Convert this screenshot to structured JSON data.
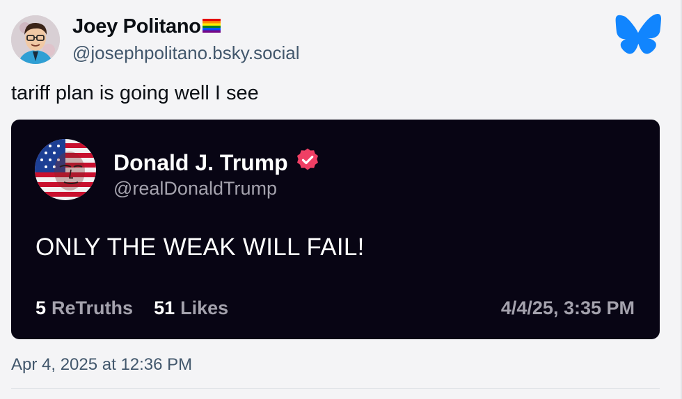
{
  "author": {
    "display_name": "Joey Politano",
    "handle": "@josephpolitano.bsky.social",
    "flag_icon": "rainbow-flag-icon"
  },
  "platform_logo": "bluesky-butterfly-icon",
  "post": {
    "text": "tariff plan is going well I see",
    "timestamp": "Apr 4, 2025 at 12:36 PM"
  },
  "embed": {
    "display_name": "Donald J. Trump",
    "handle": "@realDonaldTrump",
    "verified_icon": "verified-badge-icon",
    "text": "ONLY THE WEAK WILL FAIL!",
    "retruths_count": "5",
    "retruths_label": "ReTruths",
    "likes_count": "51",
    "likes_label": "Likes",
    "date": "4/4/25, 3:35 PM"
  },
  "colors": {
    "brand": "#1185fe",
    "verified": "#ef3f64",
    "embed_bg": "#080514"
  }
}
